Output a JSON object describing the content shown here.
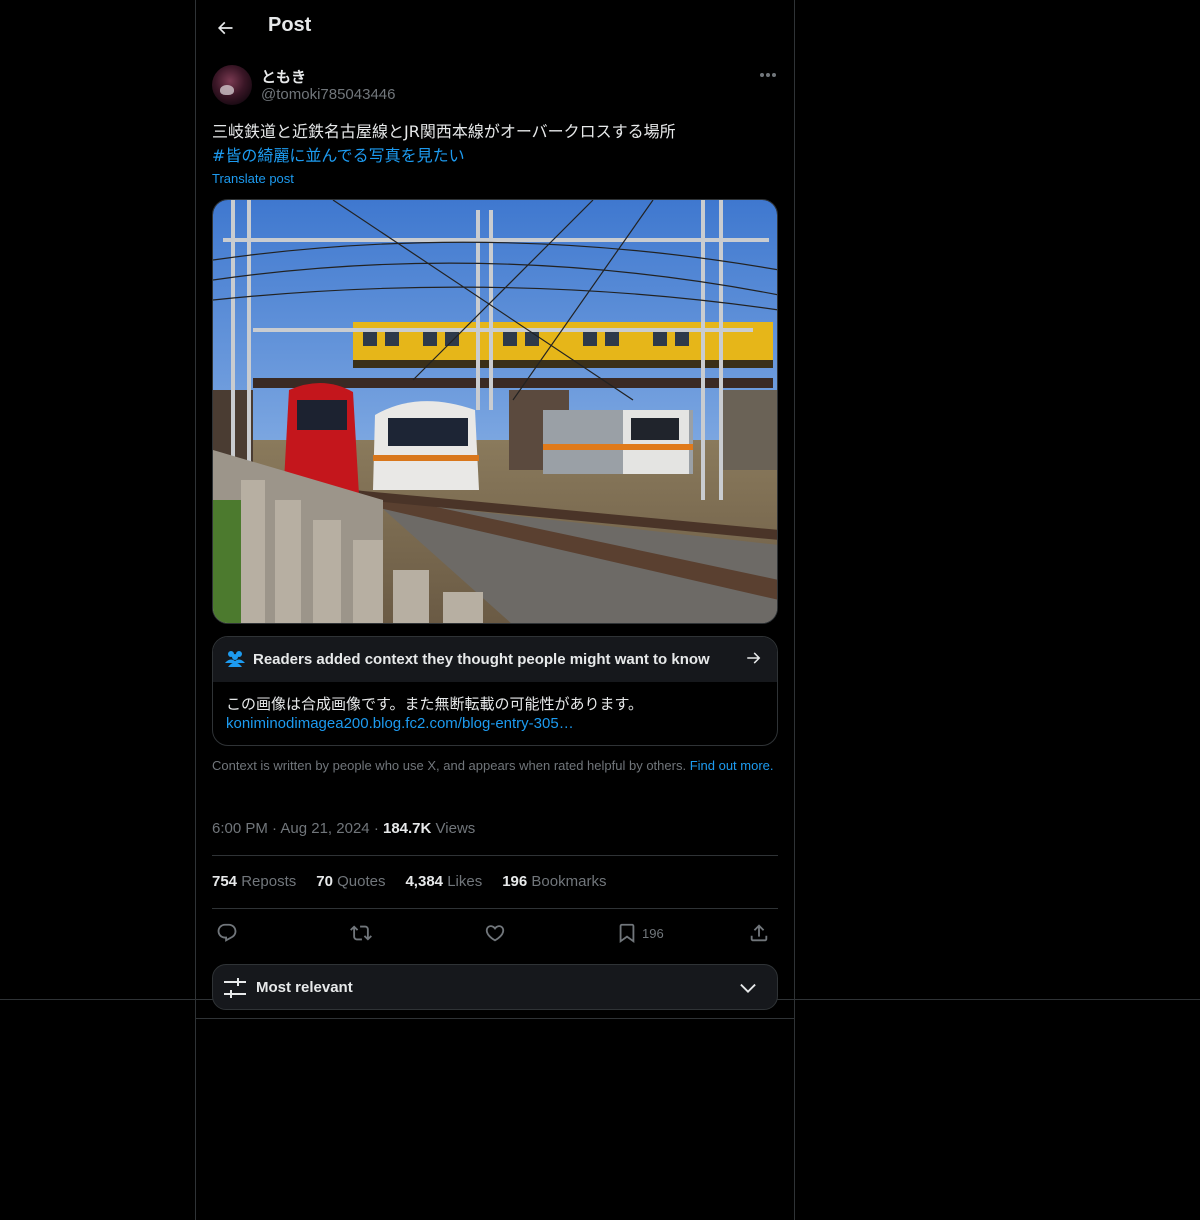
{
  "header": {
    "title": "Post",
    "back_icon": "arrow-left-icon"
  },
  "post": {
    "author": {
      "display_name": "ともき",
      "handle": "@tomoki785043446"
    },
    "text": "三岐鉄道と近鉄名古屋線とJR関西本線がオーバークロスする場所",
    "hashtag": "#皆の綺麗に並んでる写真を見たい",
    "translate_label": "Translate post",
    "media_alt_icon": "photo-trains-crossing",
    "community_note": {
      "title": "Readers added context they thought people might want to know",
      "body": "この画像は合成画像です。また無断転載の可能性があります。",
      "link": "koniminodimagea200.blog.fc2.com/blog-entry-305…",
      "footer": "Context is written by people who use X, and appears when rated helpful by others.",
      "footer_link": "Find out more."
    },
    "time": "6:00 PM",
    "date": "Aug 21, 2024",
    "views_count": "184.7K",
    "views_label": "Views",
    "stats": {
      "reposts_count": "754",
      "reposts_label": "Reposts",
      "quotes_count": "70",
      "quotes_label": "Quotes",
      "likes_count": "4,384",
      "likes_label": "Likes",
      "bookmarks_count": "196",
      "bookmarks_label": "Bookmarks"
    },
    "actions": {
      "bookmark_count": "196"
    }
  },
  "replies_sort": {
    "label": "Most relevant"
  },
  "colors": {
    "accent": "#1d9bf0",
    "text": "#e7e9ea",
    "muted": "#71767b",
    "border": "#2f3336",
    "background": "#000000"
  }
}
